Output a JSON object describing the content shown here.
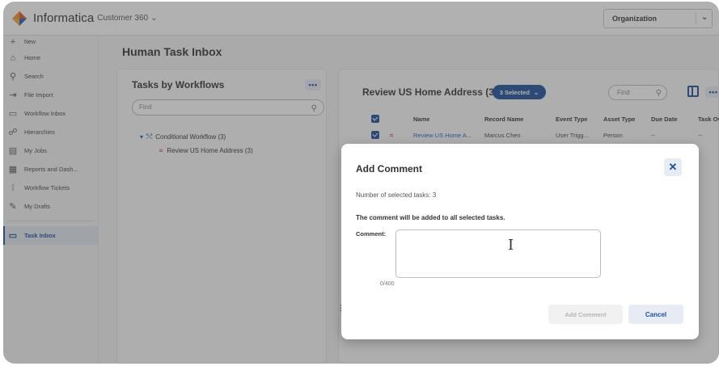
{
  "header": {
    "brand": "Informatica",
    "product": "Customer 360",
    "org_select": "Organization"
  },
  "sidebar": {
    "new_label": "New",
    "items": [
      {
        "label": "Home",
        "icon": "home-icon"
      },
      {
        "label": "Search",
        "icon": "search-icon"
      },
      {
        "label": "File Import",
        "icon": "file-import-icon"
      },
      {
        "label": "Workflow Inbox",
        "icon": "inbox-icon"
      },
      {
        "label": "Hierarchies",
        "icon": "hierarchy-icon"
      },
      {
        "label": "My Jobs",
        "icon": "jobs-icon"
      },
      {
        "label": "Reports and Dash...",
        "icon": "reports-icon"
      },
      {
        "label": "Workflow Tickets",
        "icon": "tickets-icon"
      },
      {
        "label": "My Drafts",
        "icon": "drafts-icon"
      }
    ],
    "active_item": {
      "label": "Task Inbox",
      "icon": "task-inbox-icon"
    }
  },
  "main": {
    "page_title": "Human Task Inbox",
    "left_panel": {
      "title": "Tasks by Workflows",
      "find_placeholder": "Find",
      "tree": {
        "workflow": "Conditional Workflow (3)",
        "child": "Review US Home Address (3)"
      }
    },
    "right_panel": {
      "title": "Review US Home Address (3)",
      "selected_label": "3 Selected",
      "find_placeholder": "Find",
      "columns": [
        "Name",
        "Record Name",
        "Event Type",
        "Asset Type",
        "Due Date",
        "Task Ov"
      ],
      "rows": [
        {
          "name": "Review US Home A...",
          "record": "Marcus Chen",
          "event": "User Trigg...",
          "asset": "Person",
          "due": "--",
          "owner": "--"
        }
      ]
    }
  },
  "modal": {
    "title": "Add Comment",
    "count_text": "Number of selected tasks: 3",
    "note": "The comment will be added to all selected tasks.",
    "comment_label": "Comment:",
    "comment_value": "",
    "counter": "0/400",
    "add_button": "Add Comment",
    "cancel_button": "Cancel",
    "close_glyph": "✕"
  },
  "colors": {
    "accent": "#1d4f9c",
    "link": "#1d5fbf",
    "priority": "#d23a3a",
    "overlay": "rgba(70,70,70,0.42)"
  }
}
